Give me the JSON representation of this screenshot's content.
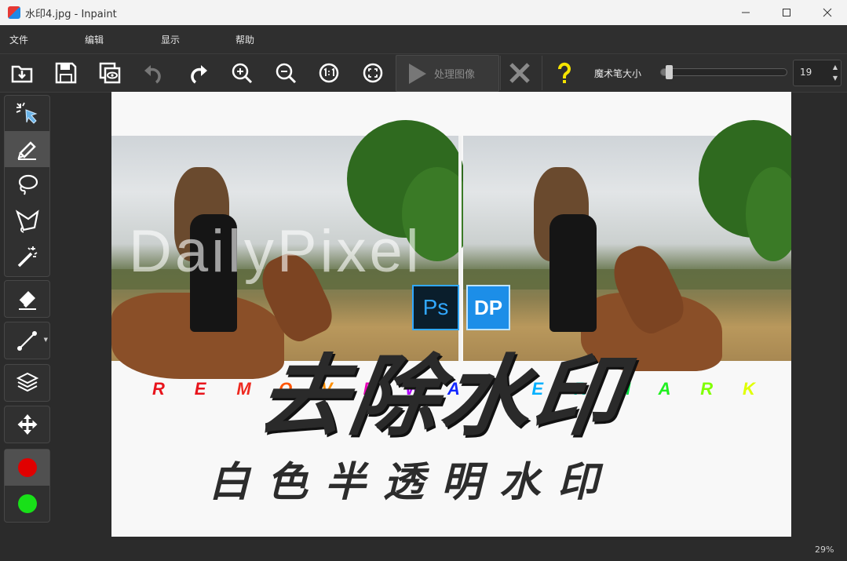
{
  "window": {
    "title": "水印4.jpg - Inpaint"
  },
  "menu": {
    "items": [
      "文件",
      "编辑",
      "显示",
      "帮助"
    ]
  },
  "toolbar": {
    "process_label": "处理图像",
    "brush_size_label": "魔术笔大小",
    "brush_size_value": "19",
    "brush_size_fraction": 0.04
  },
  "canvas": {
    "watermark_text": "DailyPixel",
    "ps_logo_text": "Ps",
    "dp_logo_text": "DP",
    "remove_letters": [
      "R",
      "E",
      "M",
      "O",
      "V",
      "E",
      "W",
      "A",
      "T",
      "E",
      "R",
      "M",
      "A",
      "R",
      "K"
    ],
    "remove_colors": [
      "#e8141c",
      "#e8141c",
      "#ee2a20",
      "#ff5400",
      "#ff8e00",
      "#e800b8",
      "#b000ff",
      "#1428ff",
      "#0050ff",
      "#00b0ff",
      "#00e4c0",
      "#00e040",
      "#20f020",
      "#80ff00",
      "#e0ff00"
    ],
    "title": "去除水印",
    "subtitle": "白色半透明水印"
  },
  "status": {
    "zoom": "29%"
  },
  "colors": {
    "primary": "#e00000",
    "secondary": "#18e018"
  }
}
